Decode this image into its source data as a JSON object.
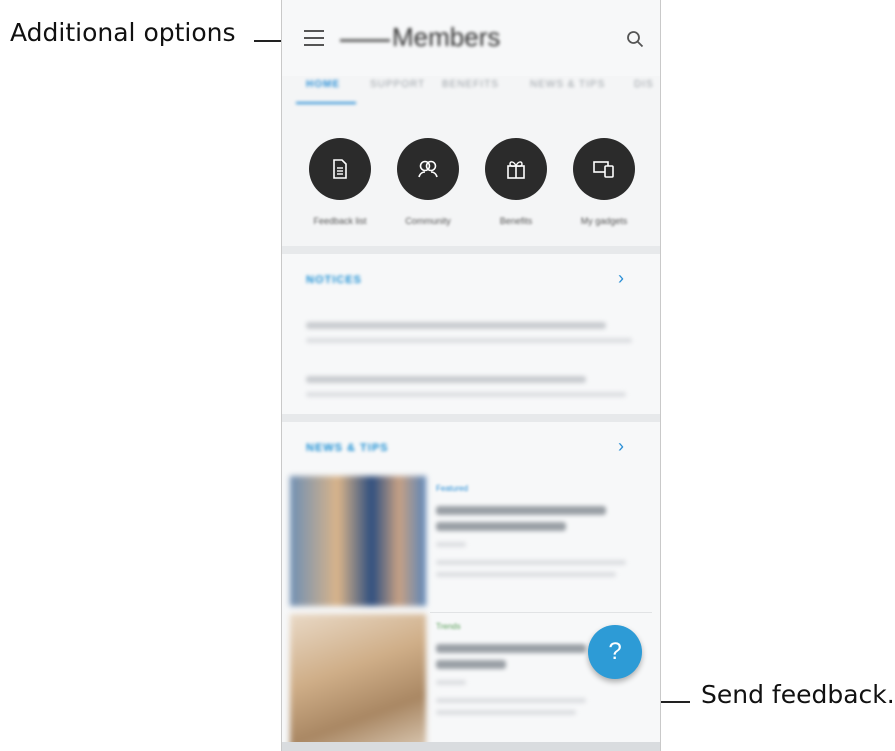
{
  "callouts": {
    "left": "Additional options",
    "right": "Send feedback."
  },
  "app": {
    "title": "Members",
    "tabs": [
      "HOME",
      "SUPPORT",
      "BENEFITS",
      "NEWS & TIPS",
      "DIS"
    ],
    "quick_actions": [
      {
        "icon": "document-icon",
        "label": "Feedback list"
      },
      {
        "icon": "community-icon",
        "label": "Community"
      },
      {
        "icon": "gift-icon",
        "label": "Benefits"
      },
      {
        "icon": "devices-icon",
        "label": "My gadgets"
      }
    ],
    "notices": {
      "title": "NOTICES"
    },
    "news": {
      "title": "NEWS & TIPS",
      "items": [
        {
          "tag": "Featured"
        },
        {
          "tag": "Trends"
        }
      ]
    },
    "fab_label": "?"
  },
  "colors": {
    "accent": "#2a8fd6",
    "fab": "#2d9bd6",
    "quick_icon_bg": "#2b2b2b"
  }
}
